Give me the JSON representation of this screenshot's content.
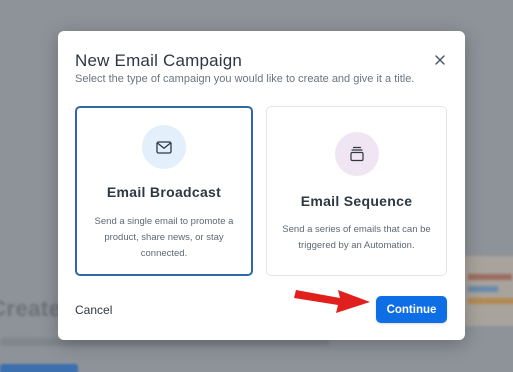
{
  "modal": {
    "title": "New Email Campaign",
    "subtitle": "Select the type of campaign you would like to create and give it a title.",
    "close_icon": "close-icon"
  },
  "cards": [
    {
      "title": "Email Broadcast",
      "description": "Send a single email to promote a product, share news, or stay connected.",
      "icon": "mail-icon",
      "selected": true
    },
    {
      "title": "Email Sequence",
      "description": "Send a series of emails that can be triggered by an Automation.",
      "icon": "sequence-stack-icon",
      "selected": false
    }
  ],
  "footer": {
    "cancel_label": "Cancel",
    "continue_label": "Continue"
  },
  "background": {
    "heading_fragment": "Create"
  },
  "colors": {
    "accent": "#0d6ee6",
    "selected_border": "#2f6aa8",
    "annotation_arrow": "#e0201c",
    "broadcast_icon_bg": "#e3effa",
    "sequence_icon_bg": "#efe5f3"
  }
}
